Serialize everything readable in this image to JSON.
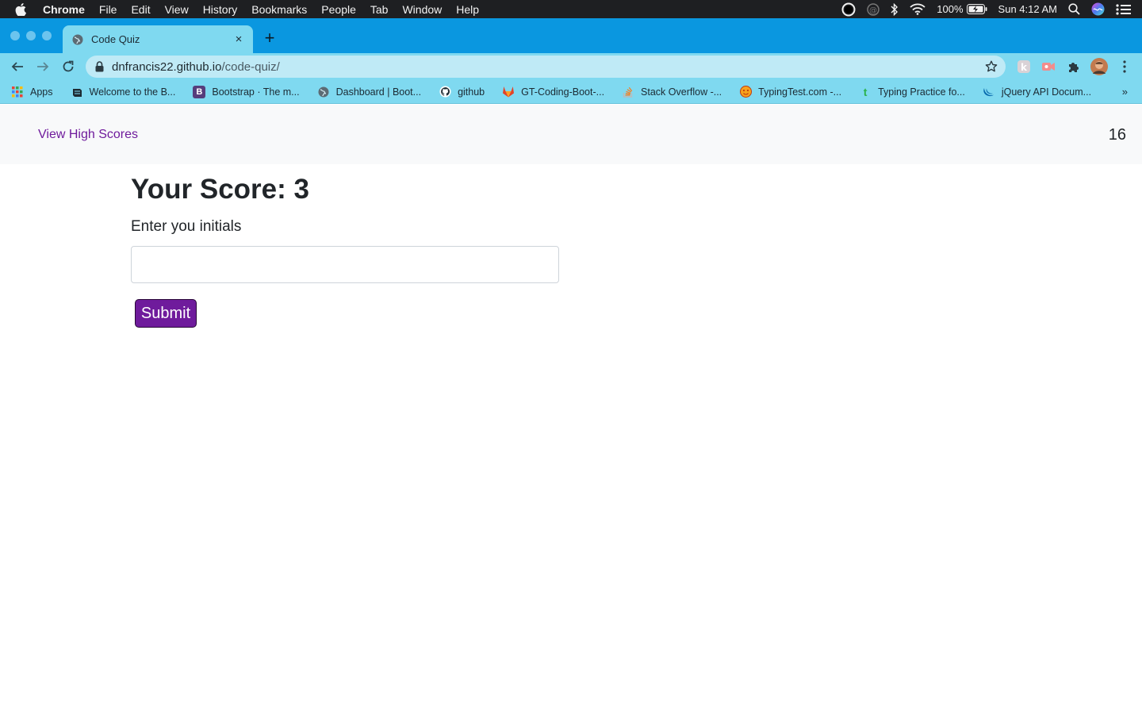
{
  "menubar": {
    "app": "Chrome",
    "items": [
      "File",
      "Edit",
      "View",
      "History",
      "Bookmarks",
      "People",
      "Tab",
      "Window",
      "Help"
    ],
    "battery": "100%",
    "clock": "Sun 4:12 AM"
  },
  "browser": {
    "tab_title": "Code Quiz",
    "close_glyph": "×",
    "newtab_glyph": "+",
    "url_host": "dnfrancis22.github.io",
    "url_path": "/code-quiz/",
    "bookmarks": [
      {
        "label": "Apps",
        "icon": "apps-grid-icon"
      },
      {
        "label": "Welcome to the B...",
        "icon": "bootcamp-icon"
      },
      {
        "label": "Bootstrap · The m...",
        "icon": "bootstrap-icon"
      },
      {
        "label": "Dashboard | Boot...",
        "icon": "globe-icon"
      },
      {
        "label": "github",
        "icon": "github-icon"
      },
      {
        "label": "GT-Coding-Boot-...",
        "icon": "gitlab-icon"
      },
      {
        "label": "Stack Overflow -...",
        "icon": "stackoverflow-icon"
      },
      {
        "label": "TypingTest.com -...",
        "icon": "typingtest-icon"
      },
      {
        "label": "Typing Practice fo...",
        "icon": "typing-icon"
      },
      {
        "label": "jQuery API Docum...",
        "icon": "jquery-icon"
      }
    ],
    "bookmarks_more": "»"
  },
  "colors": {
    "accent": "#6f1b9c",
    "tabstrip": "#0a97e0",
    "toolbar": "#7fd9f0"
  },
  "page": {
    "nav_link": "View High Scores",
    "timer": "16",
    "score_title": "Your Score: 3",
    "initials_label": "Enter you initials",
    "initials_value": "",
    "submit_label": "Submit"
  }
}
